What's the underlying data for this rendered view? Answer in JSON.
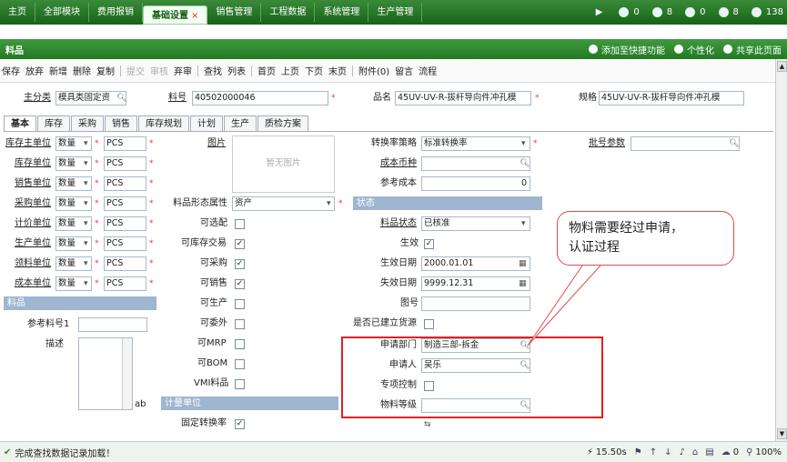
{
  "topnav": {
    "tabs": [
      "主页",
      "全部模块",
      "费用报销",
      "基础设置",
      "销售管理",
      "工程数据",
      "系统管理",
      "生产管理"
    ],
    "active_close": "×",
    "counters": [
      "0",
      "8",
      "0",
      "8",
      "138"
    ]
  },
  "titlebar": {
    "title": "料品",
    "links": [
      "添加至快捷功能",
      "个性化",
      "共享此页面"
    ]
  },
  "toolbar": {
    "items": [
      "保存",
      "放弃",
      "新增",
      "删除",
      "复制",
      "提交",
      "审核",
      "弃审",
      "查找",
      "列表",
      "首页",
      "上页",
      "下页",
      "末页",
      "附件(0)",
      "留言",
      "流程"
    ]
  },
  "header": {
    "category_label": "主分类",
    "category_value": "模具类固定资",
    "code_label": "料号",
    "code_value": "40502000046",
    "name_label": "品名",
    "name_value": "45UV-UV-R-拔杆导向件冲孔模",
    "spec_label": "规格",
    "spec_value": "45UV-UV-R-拔杆导向件冲孔模"
  },
  "tabs": [
    "基本",
    "库存",
    "采购",
    "销售",
    "库存规划",
    "计划",
    "生产",
    "质检方案"
  ],
  "units": {
    "rows": [
      {
        "label": "库存主单位",
        "type": "数量",
        "unit": "PCS"
      },
      {
        "label": "库存单位",
        "type": "数量",
        "unit": "PCS"
      },
      {
        "label": "销售单位",
        "type": "数量",
        "unit": "PCS"
      },
      {
        "label": "采购单位",
        "type": "数量",
        "unit": "PCS"
      },
      {
        "label": "计价单位",
        "type": "数量",
        "unit": "PCS"
      },
      {
        "label": "生产单位",
        "type": "数量",
        "unit": "PCS"
      },
      {
        "label": "领料单位",
        "type": "数量",
        "unit": "PCS"
      },
      {
        "label": "成本单位",
        "type": "数量",
        "unit": "PCS"
      }
    ]
  },
  "section_item": "料品",
  "ref_code_label": "参考料号1",
  "desc_label": "描述",
  "textarea_btn": "ab",
  "mid": {
    "image_label": "图片",
    "image_placeholder": "暂无图片",
    "form_label": "料品形态属性",
    "form_value": "资产",
    "checks": [
      {
        "label": "可选配",
        "checked": false
      },
      {
        "label": "可库存交易",
        "checked": true
      },
      {
        "label": "可采购",
        "checked": true
      },
      {
        "label": "可销售",
        "checked": true
      },
      {
        "label": "可生产",
        "checked": false
      },
      {
        "label": "可委外",
        "checked": false
      },
      {
        "label": "可MRP",
        "checked": false
      },
      {
        "label": "可BOM",
        "checked": false
      },
      {
        "label": "VMI料品",
        "checked": false
      }
    ],
    "section_unit": "计量单位",
    "fixed_label": "固定转换率",
    "fixed_checked": true
  },
  "right": {
    "strategy_label": "转换率策略",
    "strategy_value": "标准转换率",
    "currency_label": "成本币种",
    "currency_value": "",
    "refcost_label": "参考成本",
    "refcost_value": "0",
    "state_section": "状态",
    "status_label": "料品状态",
    "status_value": "已核准",
    "effective_label": "生效",
    "effective_checked": true,
    "start_label": "生效日期",
    "start_value": "2000.01.01",
    "end_label": "失效日期",
    "end_value": "9999.12.31",
    "drawing_label": "图号",
    "drawing_value": "",
    "source_label": "是否已建立货源",
    "dept_label": "申请部门",
    "dept_value": "制造三部-拆金",
    "applicant_label": "申请人",
    "applicant_value": "吴乐",
    "special_label": "专项控制",
    "grade_label": "物料等级",
    "grade_value": "",
    "batch_label": "批号参数",
    "spec_label2": "规格"
  },
  "callout": {
    "line1": "物料需要经过申请，",
    "line2": "认证过程"
  },
  "status": {
    "message": "完成查找数据记录加载！",
    "time": "15.50s",
    "zoom": "100%",
    "count": "0"
  }
}
